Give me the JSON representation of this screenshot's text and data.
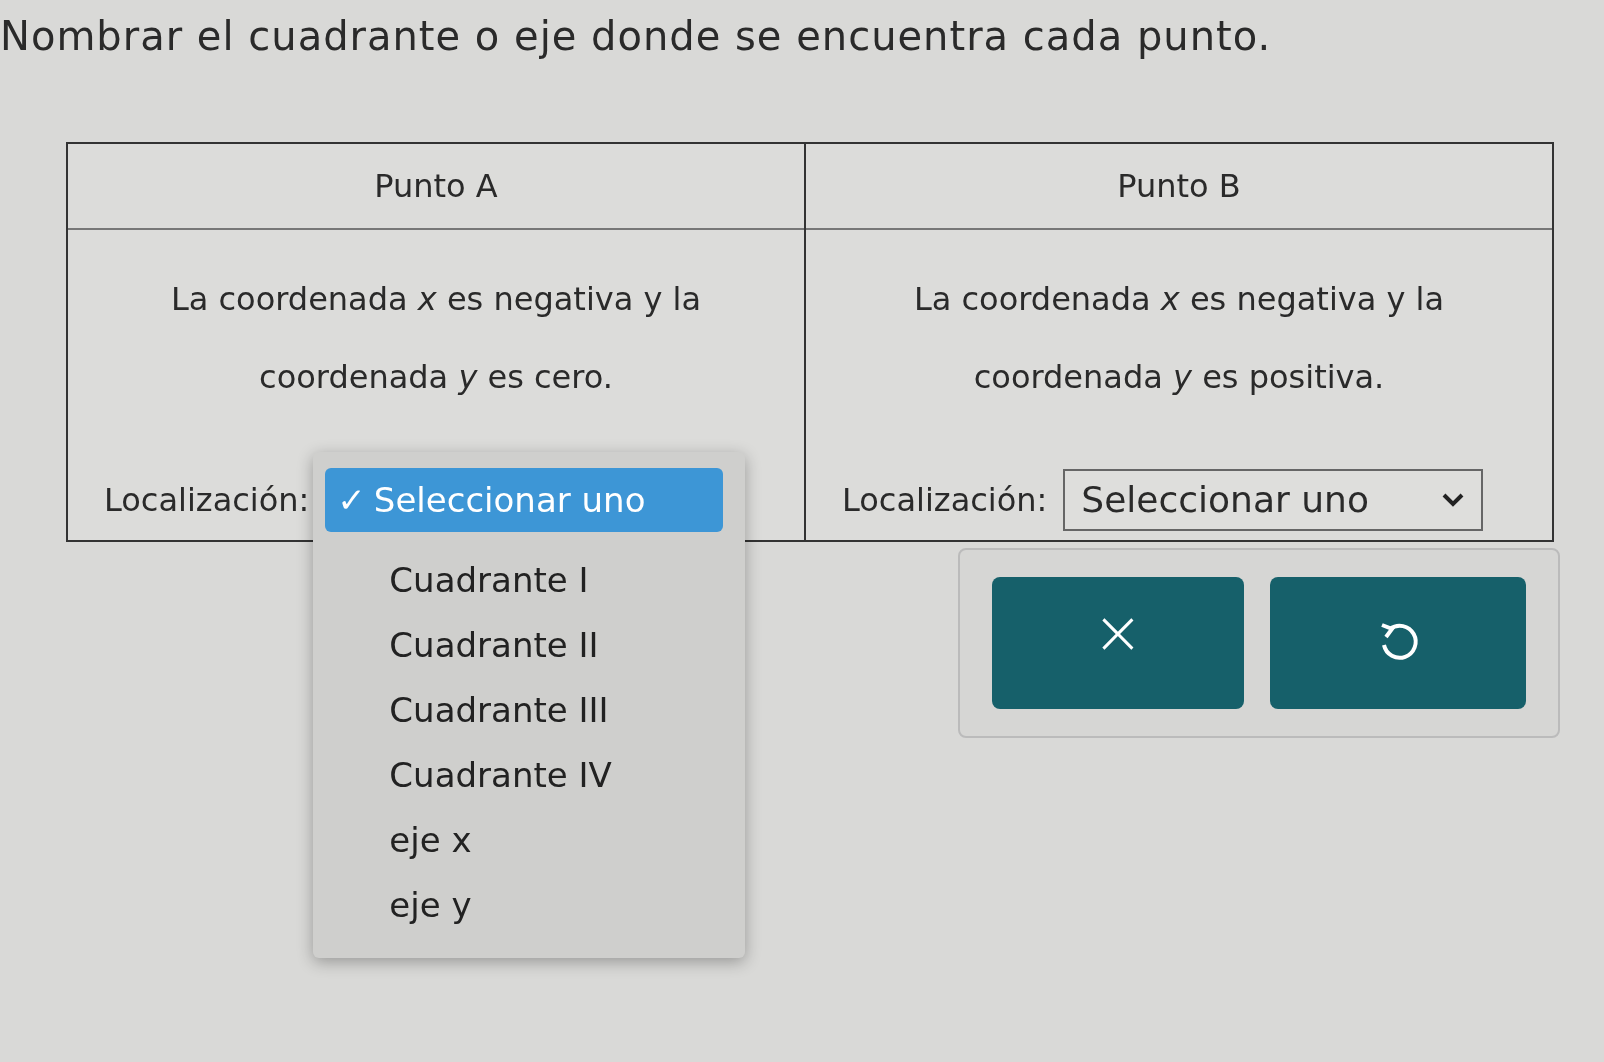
{
  "instruction": "Nombrar el cuadrante o eje donde se encuentra cada punto.",
  "points": [
    {
      "header": "Punto A",
      "description": "La coordenada *x* es negativa y la coordenada *y* es cero.",
      "location_label": "Localización:",
      "select": {
        "value": "Seleccionar uno",
        "check": "✓",
        "expanded": true,
        "options": [
          {
            "label": "Cuadrante I",
            "selected": false
          },
          {
            "label": "Cuadrante II",
            "selected": false
          },
          {
            "label": "Cuadrante III",
            "selected": false
          },
          {
            "label": "Cuadrante IV",
            "selected": false
          },
          {
            "label": "eje x",
            "selected": false
          },
          {
            "label": "eje y",
            "selected": false
          }
        ]
      }
    },
    {
      "header": "Punto B",
      "description": "La coordenada *x* es negativa y la coordenada *y* es positiva.",
      "location_label": "Localización:",
      "select": {
        "value": "Seleccionar uno",
        "expanded": false
      }
    }
  ],
  "buttons": [
    {
      "kind": "clear",
      "label": "×"
    },
    {
      "kind": "reset"
    }
  ]
}
